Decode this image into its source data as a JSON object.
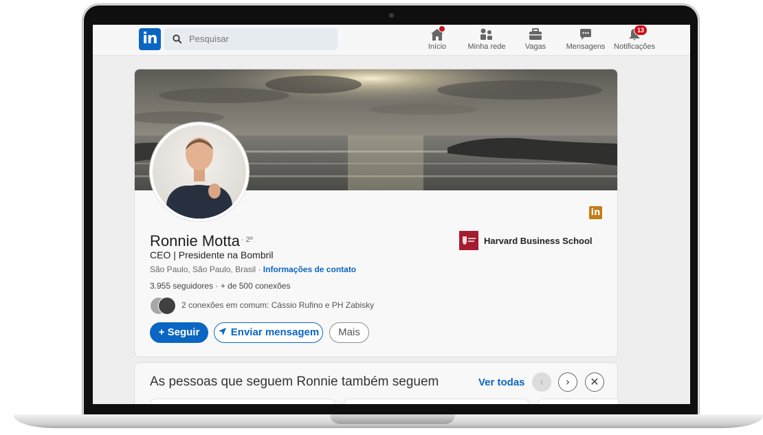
{
  "nav": {
    "search_placeholder": "Pesquisar",
    "items": [
      {
        "label": "Início",
        "icon": "home-icon"
      },
      {
        "label": "Minha rede",
        "icon": "network-icon"
      },
      {
        "label": "Vagas",
        "icon": "briefcase-icon"
      },
      {
        "label": "Mensagens",
        "icon": "messaging-icon"
      },
      {
        "label": "Notificações",
        "icon": "bell-icon",
        "badge": "13"
      }
    ]
  },
  "profile": {
    "name": "Ronnie Motta",
    "degree": "· 2º",
    "headline": "CEO | Presidente na Bombril",
    "location": "São Paulo, São Paulo, Brasil ·",
    "contact_link": "Informações de contato",
    "stats": "3.955 seguidores  · + de 500 conexões",
    "mutual_prefix": "2 conexões em comum:",
    "mutual_names": "Cássio Rufino e PH Zabisky",
    "education": "Harvard Business School",
    "buttons": {
      "follow": "+ Seguir",
      "message": "Enviar mensagem",
      "more": "Mais"
    }
  },
  "also_follow": {
    "title": "As pessoas que seguem Ronnie também seguem",
    "see_all": "Ver todas"
  },
  "colors": {
    "linkedin_blue": "#0a66c2",
    "notification_red": "#cc1016",
    "harvard_crimson": "#a51c30"
  }
}
